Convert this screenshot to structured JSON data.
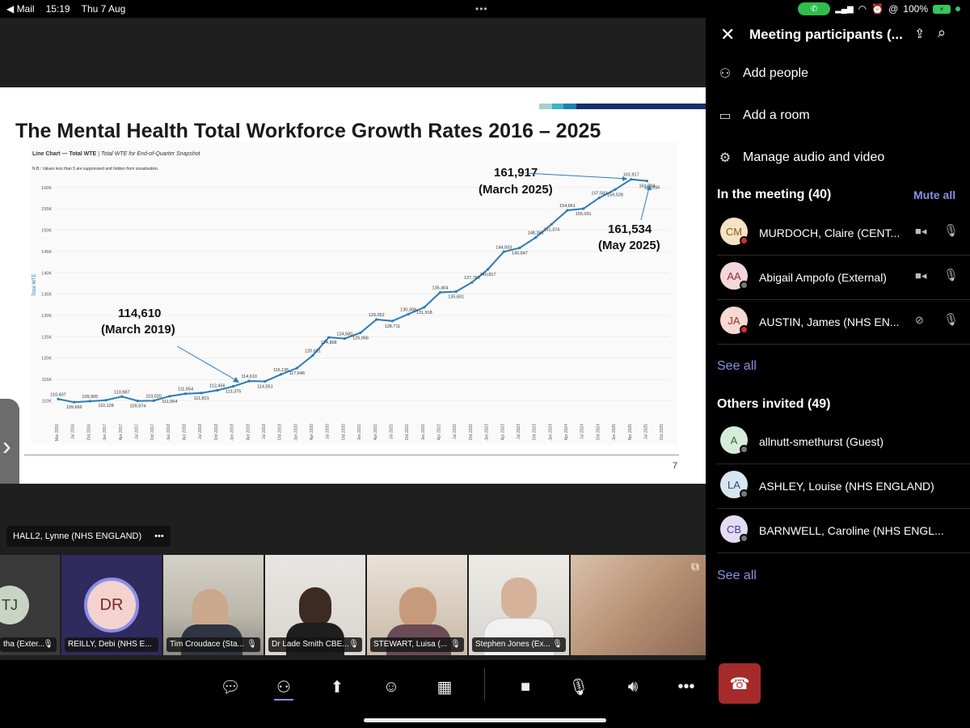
{
  "status_bar": {
    "back_app": "◀ Mail",
    "time": "15:19",
    "date": "Thu 7 Aug",
    "battery": "100%"
  },
  "slide": {
    "title": "The Mental Health Total Workforce Growth Rates 2016 – 2025",
    "chart_header_bold": "Line Chart — Total WTE",
    "chart_header_rest": " | Total WTE for End-of-Quarter Snapshot",
    "note": "N.B.: Values less than 5 are suppressed and hidden from visualisation.",
    "yaxis_label": "Total WTE",
    "callouts": [
      {
        "value": "161,917",
        "when": "(March 2025)"
      },
      {
        "value": "161,534",
        "when": "(May 2025)"
      },
      {
        "value": "114,610",
        "when": "(March 2019)"
      }
    ],
    "page_number": "7"
  },
  "chart_data": {
    "type": "line",
    "ylabel": "Total WTE",
    "ylim": [
      108000,
      163000
    ],
    "yticks": [
      "110K",
      "115K",
      "120K",
      "125K",
      "130K",
      "135K",
      "140K",
      "145K",
      "150K",
      "155K",
      "160K"
    ],
    "x": [
      "Mar 2016",
      "Jun 2016",
      "Sep 2016",
      "Dec 2016",
      "Mar 2017",
      "Jun 2017",
      "Sep 2017",
      "Dec 2017",
      "Mar 2018",
      "Jun 2018",
      "Sep 2018",
      "Dec 2018",
      "Mar 2019",
      "Jun 2019",
      "Sep 2019",
      "Dec 2019",
      "Mar 2020",
      "Jun 2020",
      "Sep 2020",
      "Dec 2020",
      "Mar 2021",
      "Jun 2021",
      "Sep 2021",
      "Dec 2021",
      "Mar 2022",
      "Jun 2022",
      "Sep 2022",
      "Dec 2022",
      "Mar 2023",
      "Jun 2023",
      "Sep 2023",
      "Dec 2023",
      "Mar 2024",
      "Jun 2024",
      "Sep 2024",
      "Dec 2024",
      "Mar 2025",
      "May 2025"
    ],
    "xtick_labels": [
      "Mar 2016",
      "Jul 2016",
      "Oct 2016",
      "Jan 2017",
      "Apr 2017",
      "Jul 2017",
      "Oct 2017",
      "Jan 2018",
      "Apr 2018",
      "Jul 2018",
      "Oct 2018",
      "Jan 2019",
      "Apr 2019",
      "Jul 2019",
      "Oct 2019",
      "Jan 2020",
      "Apr 2020",
      "Jul 2020",
      "Oct 2020",
      "Jan 2021",
      "Apr 2021",
      "Jul 2021",
      "Oct 2021",
      "Jan 2022",
      "Apr 2022",
      "Jul 2022",
      "Oct 2022",
      "Jan 2023",
      "Apr 2023",
      "Jul 2023",
      "Oct 2023",
      "Jan 2024",
      "Apr 2024",
      "Jul 2024",
      "Oct 2024",
      "Jan 2025",
      "Apr 2025",
      "Jul 2025",
      "Oct 2025"
    ],
    "values": [
      110407,
      109666,
      109905,
      110128,
      110987,
      109974,
      110020,
      111064,
      111654,
      111821,
      112456,
      113375,
      114610,
      114551,
      116195,
      117646,
      120631,
      124868,
      124580,
      125956,
      129052,
      128711,
      130308,
      131918,
      135404,
      135601,
      137760,
      140817,
      144933,
      145847,
      148265,
      151374,
      154661,
      155031,
      157583,
      159528,
      161917,
      161534
    ],
    "point_labels": [
      "110,407",
      "109,666",
      "109,905",
      "110,128",
      "110,987",
      "109,974",
      "110,020",
      "111,064",
      "111,654",
      "111,821",
      "112,456",
      "113,375",
      "114,610",
      "114,551",
      "116,195",
      "117,646",
      "120,631",
      "124,868",
      "124,580",
      "125,956",
      "129,052",
      "128,711",
      "130,308",
      "131,918",
      "135,404",
      "135,601",
      "137,760",
      "140,817",
      "144,933",
      "145,847",
      "148,265",
      "151,374",
      "154,661",
      "155,031",
      "157,583",
      "159,528",
      "161,917",
      "161,534"
    ],
    "extra_label": "161,556",
    "line_color": "#2c7bb6"
  },
  "stage": {
    "presenter_chip": "HALL2, Lynne (NHS ENGLAND)",
    "more": "•••",
    "tiles": [
      {
        "initials": "TJ",
        "label": "tha (Exter..."
      },
      {
        "initials": "DR",
        "label": "REILLY, Debi (NHS E..."
      },
      {
        "label": "Tim Croudace (Sta..."
      },
      {
        "label": "Dr Lade Smith CBE..."
      },
      {
        "label": "STEWART, Luisa (..."
      },
      {
        "label": "Stephen Jones (Ex..."
      }
    ]
  },
  "panel": {
    "title": "Meeting participants (...",
    "actions": [
      "Add people",
      "Add a room",
      "Manage audio and video"
    ],
    "in_meeting_header": "In the meeting (40)",
    "mute_all": "Mute all",
    "in_meeting": [
      {
        "initials": "CM",
        "name": "MURDOCH, Claire (CENT...",
        "bg": "#f6e3c4",
        "fg": "#8a5a1a",
        "status": "#d32f2f"
      },
      {
        "initials": "AA",
        "name": "Abigail Ampofo (External)",
        "bg": "#f5d7db",
        "fg": "#8a2a3a",
        "status": "#777777"
      },
      {
        "initials": "JA",
        "name": "AUSTIN, James (NHS EN...",
        "bg": "#f7d9d4",
        "fg": "#9a3020",
        "status": "#d32f2f"
      }
    ],
    "see_all_1": "See all",
    "others_header": "Others invited (49)",
    "others": [
      {
        "initials": "A",
        "name": "allnutt-smethurst (Guest)",
        "bg": "#d6ecd8",
        "fg": "#2d6a35",
        "status": "#777777"
      },
      {
        "initials": "LA",
        "name": "ASHLEY, Louise (NHS ENGLAND)",
        "bg": "#d8e6f2",
        "fg": "#2a4d72",
        "status": "#777777"
      },
      {
        "initials": "CB",
        "name": "BARNWELL, Caroline (NHS ENGL...",
        "bg": "#e3dcf2",
        "fg": "#4b3a80",
        "status": "#777777"
      }
    ],
    "see_all_2": "See all"
  }
}
